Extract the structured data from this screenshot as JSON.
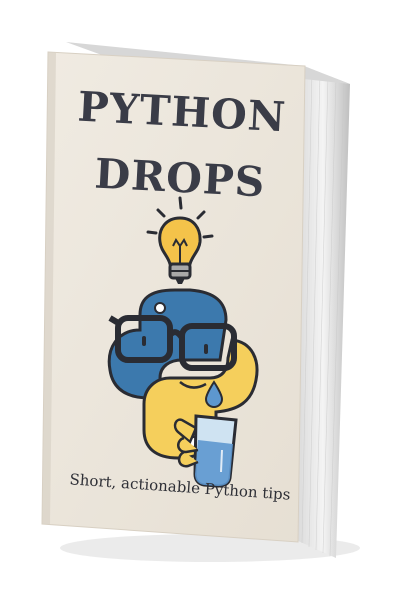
{
  "book": {
    "title_line1": "PYTHON",
    "title_line2": "DROPS",
    "subtitle": "Short, actionable Python tips",
    "illustration": {
      "icons": [
        "lightbulb-icon",
        "python-logo-with-glasses",
        "water-drop-icon",
        "glass-of-water-icon"
      ],
      "colors": {
        "cover": "#ece6dc",
        "python_blue": "#3c79ad",
        "python_yellow": "#f5cf5c",
        "outline": "#2a2c33",
        "water": "#5d97cf"
      }
    }
  }
}
